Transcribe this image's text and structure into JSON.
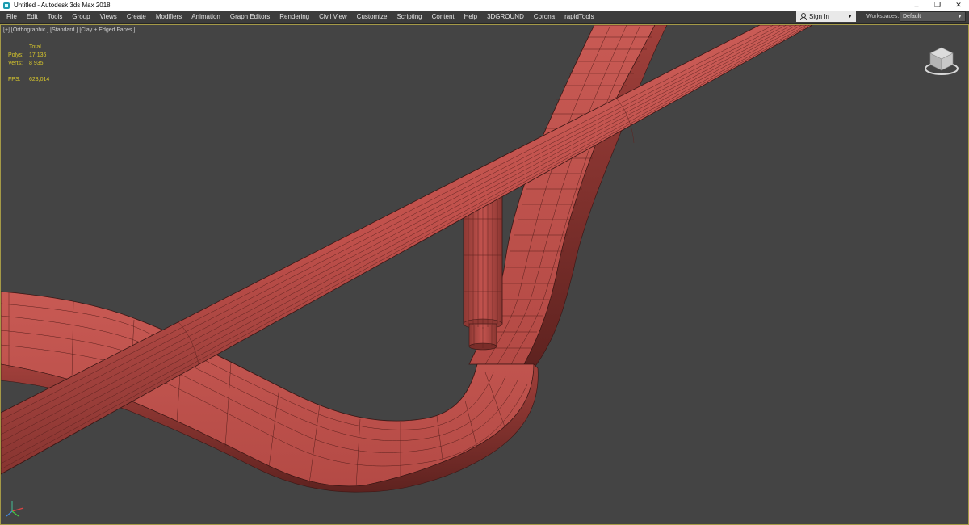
{
  "window": {
    "title": "Untitled - Autodesk 3ds Max 2018",
    "buttons": {
      "minimize": "–",
      "restore": "❐",
      "close": "✕"
    }
  },
  "menubar": {
    "items": [
      "File",
      "Edit",
      "Tools",
      "Group",
      "Views",
      "Create",
      "Modifiers",
      "Animation",
      "Graph Editors",
      "Rendering",
      "Civil View",
      "Customize",
      "Scripting",
      "Content",
      "Help",
      "3DGROUND",
      "Corona",
      "rapidTools"
    ]
  },
  "account": {
    "sign_in": "Sign In"
  },
  "workspaces": {
    "label": "Workspaces:",
    "value": "Default"
  },
  "viewport": {
    "label": "[+] [Orthographic ] [Standard ] [Clay + Edged Faces ]",
    "stats": {
      "header": "Total",
      "polys_label": "Polys:",
      "polys_value": "17 136",
      "verts_label": "Verts:",
      "verts_value": "8 935",
      "fps_label": "FPS:",
      "fps_value": "623,014"
    }
  },
  "colors": {
    "mesh": "#c0504b",
    "viewport_bg": "#444444",
    "stats_text": "#d7c62c",
    "active_border": "#a59a47"
  },
  "icons": [
    "app-icon",
    "minimize-icon",
    "restore-icon",
    "close-icon",
    "user-icon",
    "chevron-down-icon",
    "viewcube-icon",
    "axis-tripod-icon"
  ]
}
